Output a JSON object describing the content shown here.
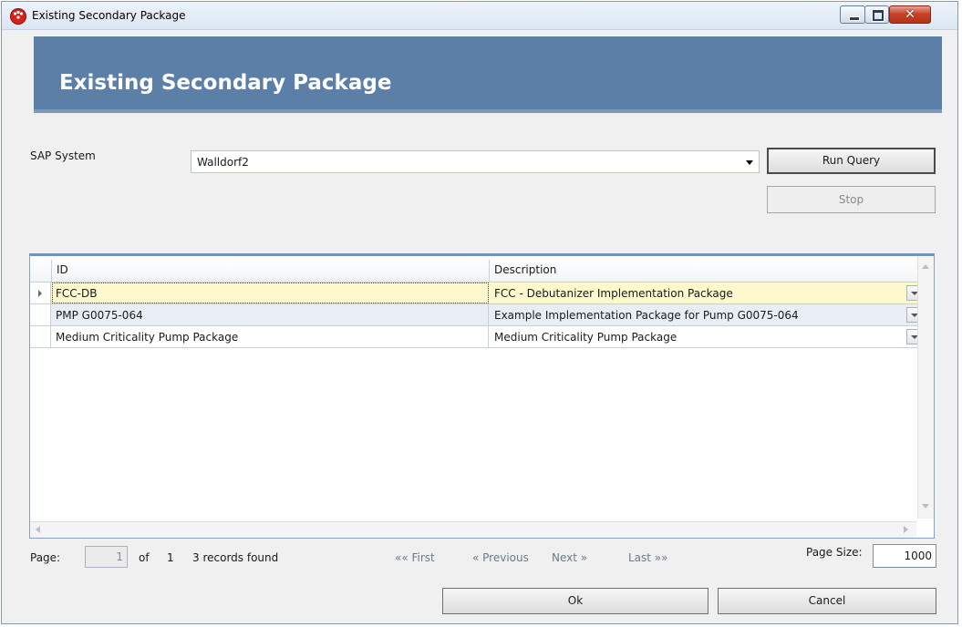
{
  "window": {
    "title": "Existing Secondary Package"
  },
  "banner": {
    "title": "Existing Secondary Package"
  },
  "sap_system": {
    "label": "SAP System",
    "value": "Walldorf2"
  },
  "buttons": {
    "run_query": "Run Query",
    "stop": "Stop",
    "ok": "Ok",
    "cancel": "Cancel"
  },
  "grid": {
    "columns": [
      "ID",
      "Description"
    ],
    "rows": [
      {
        "id": "FCC-DB",
        "description": "FCC - Debutanizer Implementation Package"
      },
      {
        "id": "PMP G0075-064",
        "description": "Example Implementation Package for Pump G0075-064"
      },
      {
        "id": "Medium Criticality Pump Package",
        "description": "Medium Criticality Pump Package"
      }
    ]
  },
  "pager": {
    "page_label": "Page:",
    "page_value": "1",
    "of_label": "of",
    "total_pages": "1",
    "records": "3 records found",
    "first": "«« First",
    "previous": "« Previous",
    "next": "Next »",
    "last": "Last »»",
    "page_size_label": "Page Size:",
    "page_size": "1000"
  },
  "colors": {
    "banner": "#5c7fa8",
    "selected_row": "#fdf9cc",
    "alt_row": "#e8edf6"
  }
}
